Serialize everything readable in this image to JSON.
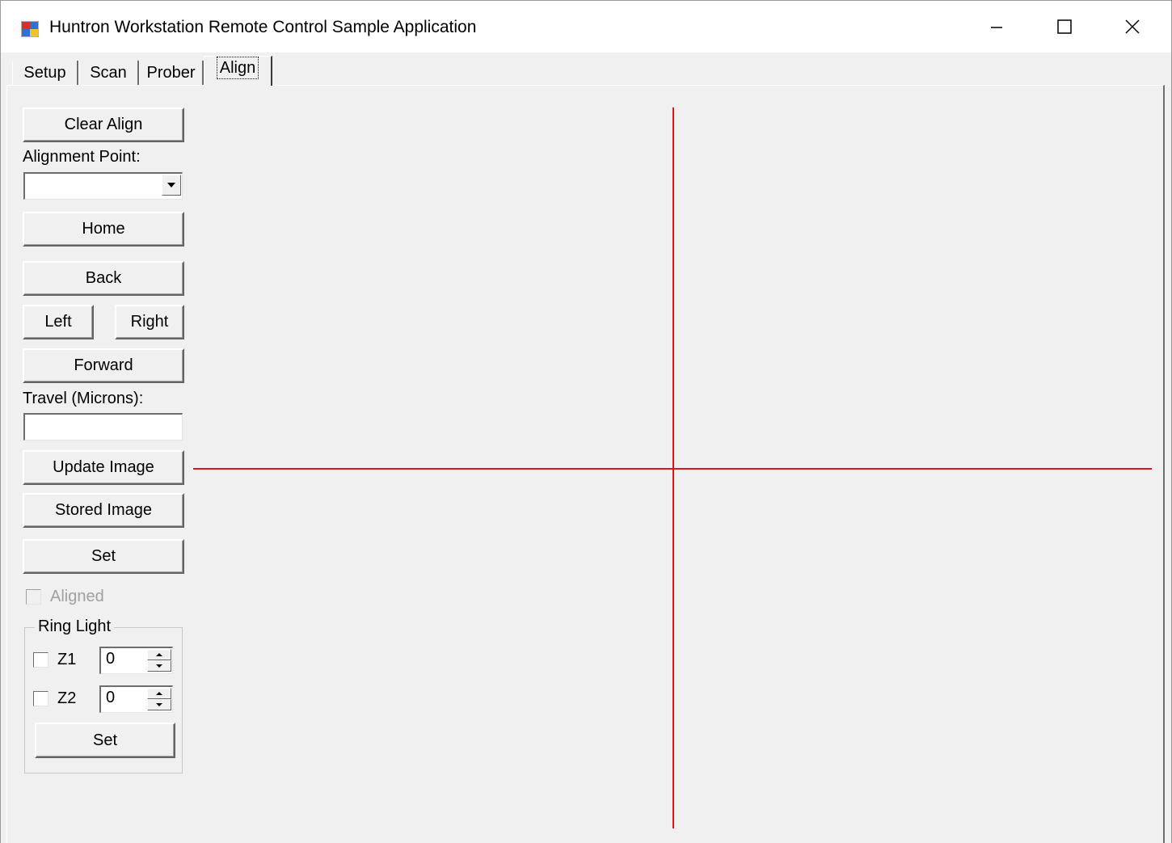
{
  "window": {
    "title": "Huntron Workstation Remote Control Sample Application"
  },
  "tabs": [
    {
      "label": "Setup"
    },
    {
      "label": "Scan"
    },
    {
      "label": "Prober"
    },
    {
      "label": "Align"
    }
  ],
  "active_tab": "Align",
  "align": {
    "clear_align_label": "Clear Align",
    "alignment_point_label": "Alignment Point:",
    "alignment_point_value": "",
    "home_label": "Home",
    "back_label": "Back",
    "left_label": "Left",
    "right_label": "Right",
    "forward_label": "Forward",
    "travel_label": "Travel (Microns):",
    "travel_value": "",
    "update_image_label": "Update Image",
    "stored_image_label": "Stored Image",
    "set_label": "Set",
    "aligned_label": "Aligned",
    "aligned_checked": false,
    "aligned_enabled": false,
    "ring_light": {
      "title": "Ring Light",
      "z1_label": "Z1",
      "z1_checked": false,
      "z1_value": "0",
      "z2_label": "Z2",
      "z2_checked": false,
      "z2_value": "0",
      "set_label": "Set"
    }
  },
  "colors": {
    "crosshair": "#e0141c",
    "background": "#f0f0f0"
  },
  "icons": {
    "app": "app-icon",
    "minimize": "minimize-icon",
    "maximize": "maximize-icon",
    "close": "close-icon",
    "dropdown": "chevron-down-icon",
    "spin_up": "spin-up-icon",
    "spin_down": "spin-down-icon"
  }
}
